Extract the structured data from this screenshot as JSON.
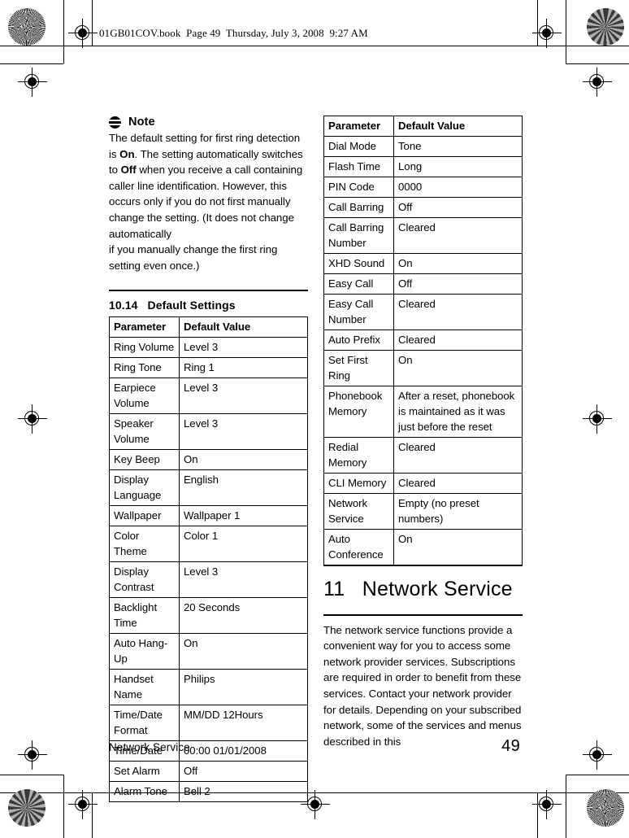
{
  "header": {
    "slug": "01GB01COV.book  Page 49  Thursday, July 3, 2008  9:27 AM"
  },
  "left_column": {
    "note": {
      "icon": "note-icon",
      "title": "Note",
      "body_html": "The default setting for first ring detection is <b>On</b>. The setting automatically switches to <b>Off</b> when you receive a call containing caller line identification. However, this occurs only if you do not first manually change the setting. (It does not change automatically<br>if you manually change the first ring setting even once.)"
    },
    "section": {
      "number": "10.14",
      "title": "Default Settings",
      "heading": "10.14   Default Settings"
    },
    "table": {
      "columns": [
        "Parameter",
        "Default Value"
      ],
      "rows": [
        [
          "Ring Volume",
          "Level 3"
        ],
        [
          "Ring Tone",
          "Ring 1"
        ],
        [
          "Earpiece Volume",
          "Level 3"
        ],
        [
          "Speaker Volume",
          "Level 3"
        ],
        [
          "Key Beep",
          "On"
        ],
        [
          "Display Language",
          "English"
        ],
        [
          "Wallpaper",
          "Wallpaper 1"
        ],
        [
          "Color Theme",
          "Color 1"
        ],
        [
          "Display Contrast",
          "Level 3"
        ],
        [
          "Backlight Time",
          "20 Seconds"
        ],
        [
          "Auto Hang-Up",
          "On"
        ],
        [
          "Handset Name",
          "Philips"
        ],
        [
          "Time/Date Format",
          "MM/DD 12Hours"
        ],
        [
          "Time/Date",
          "00:00 01/01/2008"
        ],
        [
          "Set Alarm",
          "Off"
        ],
        [
          "Alarm Tone",
          "Bell 2"
        ]
      ]
    }
  },
  "right_column": {
    "table": {
      "columns": [
        "Parameter",
        "Default Value"
      ],
      "rows": [
        [
          "Dial Mode",
          "Tone"
        ],
        [
          "Flash Time",
          "Long"
        ],
        [
          "PIN Code",
          "0000"
        ],
        [
          "Call Barring",
          "Off"
        ],
        [
          "Call Barring Number",
          "Cleared"
        ],
        [
          "XHD Sound",
          "On"
        ],
        [
          "Easy Call",
          "Off"
        ],
        [
          "Easy Call Number",
          "Cleared"
        ],
        [
          "Auto Prefix",
          "Cleared"
        ],
        [
          "Set First Ring",
          "On"
        ],
        [
          "Phonebook Memory",
          "After a reset, phonebook is maintained as it was just before the reset"
        ],
        [
          "Redial Memory",
          "Cleared"
        ],
        [
          "CLI Memory",
          "Cleared"
        ],
        [
          "Network Service",
          "Empty (no preset numbers)"
        ],
        [
          "Auto Conference",
          "On"
        ]
      ]
    },
    "chapter": {
      "number": "11",
      "title": "Network Service",
      "heading": "11   Network Service",
      "body": "The network service functions provide a convenient way for you to access some network provider services. Subscriptions are required in order to benefit from these services. Contact your network provider for details. Depending on your subscribed network, some of the services and menus described in this"
    }
  },
  "footer": {
    "chapter_name": "Network Service",
    "page_number": "49"
  },
  "prepress": {
    "registration_mark": "registration-target-icon",
    "color_star_mark": "color-star-target-icon"
  },
  "colors": {
    "ink": "#000000",
    "paper": "#ffffff"
  }
}
